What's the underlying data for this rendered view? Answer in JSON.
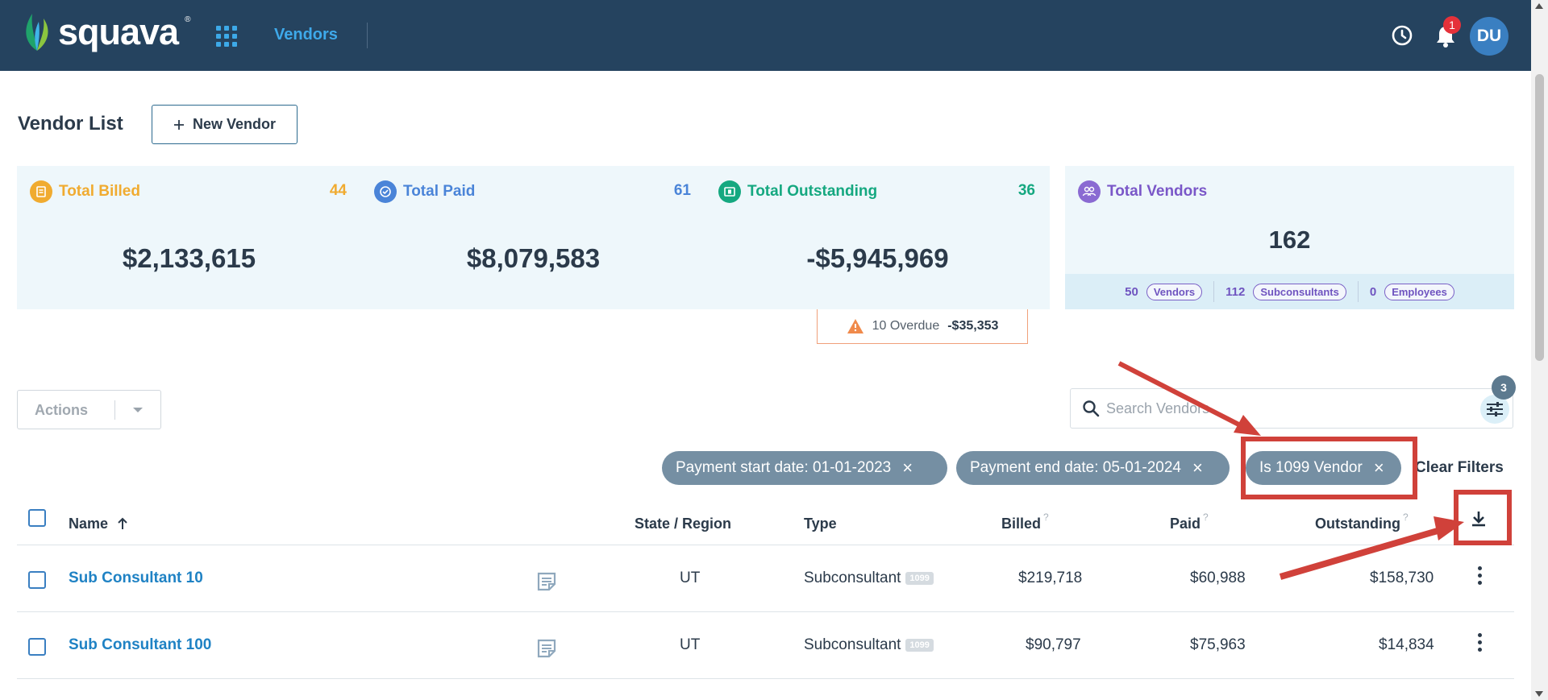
{
  "nav": {
    "logo_text": "squava",
    "logo_reg": "®",
    "active_module": "Vendors",
    "notification_count": "1",
    "user_initials": "DU"
  },
  "header": {
    "title": "Vendor List",
    "new_vendor_label": "New Vendor"
  },
  "stats": {
    "billed": {
      "label": "Total Billed",
      "count": "44",
      "amount": "$2,133,615",
      "color": "#f0ab30"
    },
    "paid": {
      "label": "Total Paid",
      "count": "61",
      "amount": "$8,079,583",
      "color": "#4a84d8"
    },
    "outstanding": {
      "label": "Total Outstanding",
      "count": "36",
      "amount": "-$5,945,969",
      "color": "#15a880"
    },
    "vendors": {
      "label": "Total Vendors",
      "total": "162",
      "breakdown": [
        {
          "count": "50",
          "label": "Vendors"
        },
        {
          "count": "112",
          "label": "Subconsultants"
        },
        {
          "count": "0",
          "label": "Employees"
        }
      ]
    }
  },
  "overdue": {
    "label": "10 Overdue",
    "amount": "-$35,353"
  },
  "toolbar": {
    "actions_label": "Actions",
    "search_placeholder": "Search Vendors",
    "filter_count": "3",
    "clear_filters_label": "Clear Filters"
  },
  "filters": [
    {
      "label": "Payment start date: 01-01-2023"
    },
    {
      "label": "Payment end date: 05-01-2024"
    },
    {
      "label": "Is 1099 Vendor"
    }
  ],
  "table": {
    "columns": {
      "name": "Name",
      "state": "State / Region",
      "type": "Type",
      "billed": "Billed",
      "paid": "Paid",
      "outstanding": "Outstanding",
      "help": "?"
    },
    "rows": [
      {
        "name": "Sub Consultant 10",
        "state": "UT",
        "type": "Subconsultant",
        "badge": "1099",
        "billed": "$219,718",
        "paid": "$60,988",
        "outstanding": "$158,730"
      },
      {
        "name": "Sub Consultant 100",
        "state": "UT",
        "type": "Subconsultant",
        "badge": "1099",
        "billed": "$90,797",
        "paid": "$75,963",
        "outstanding": "$14,834"
      }
    ]
  },
  "annotation_color": "#d0413a"
}
